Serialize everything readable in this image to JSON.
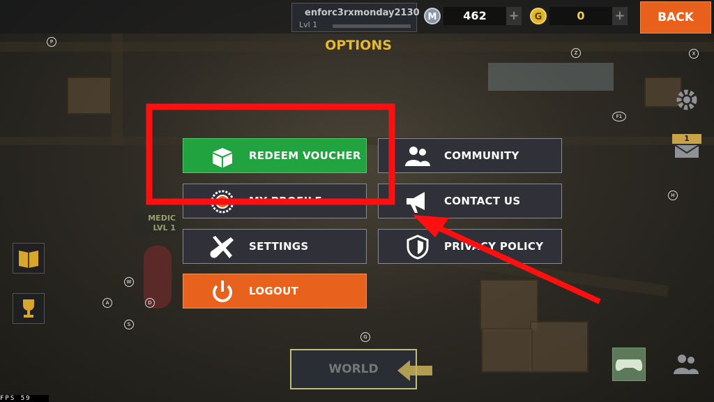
{
  "header": {
    "player_name": "enforc3rxmonday2130",
    "level_label": "Lvl",
    "level_value": "1",
    "xp_progress": 0.0,
    "currency_m": {
      "icon_text": "M",
      "value": "462",
      "plus": "+"
    },
    "currency_g": {
      "icon_text": "G",
      "value": "0",
      "plus": "+"
    },
    "back_label": "BACK"
  },
  "title": "OPTIONS",
  "menu": {
    "redeem_voucher": "REDEEM VOUCHER",
    "community": "COMMUNITY",
    "my_profile": "MY PROFILE",
    "contact_us": "CONTACT US",
    "settings": "SETTINGS",
    "privacy_policy": "PRIVACY POLICY",
    "logout": "LOGOUT"
  },
  "hotkeys": [
    "P",
    "Z",
    "X",
    "F1",
    "H",
    "W",
    "A",
    "D",
    "S",
    "G"
  ],
  "world_label": "WORLD",
  "character": {
    "class": "MEDIC",
    "level": "LVL 1"
  },
  "mail_count": "1",
  "fps_label": "FPS",
  "fps_value": "59",
  "colors": {
    "accent_orange": "#e8601c",
    "green_button": "#21a33f",
    "title_yellow": "#e6b934",
    "highlight_red": "#ff0f0f"
  }
}
